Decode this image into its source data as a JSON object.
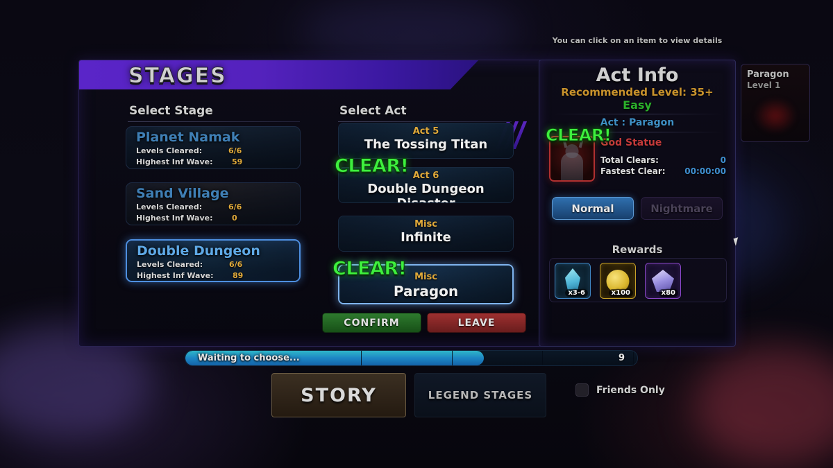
{
  "header": {
    "title": "STAGES"
  },
  "hint": "You can click on an item to view details",
  "columns": {
    "stage": "Select Stage",
    "act": "Select Act"
  },
  "stages": [
    {
      "name": "Planet Namak",
      "levels_label": "Levels Cleared:",
      "levels_value": "6/6",
      "wave_label": "Highest Inf Wave:",
      "wave_value": "59",
      "selected": false
    },
    {
      "name": "Sand Village",
      "levels_label": "Levels Cleared:",
      "levels_value": "6/6",
      "wave_label": "Highest Inf Wave:",
      "wave_value": "0",
      "selected": false
    },
    {
      "name": "Double Dungeon",
      "levels_label": "Levels Cleared:",
      "levels_value": "6/6",
      "wave_label": "Highest Inf Wave:",
      "wave_value": "89",
      "selected": true
    }
  ],
  "acts": [
    {
      "sub": "Act 5",
      "title": "The Tossing Titan",
      "clear": "",
      "selected": false
    },
    {
      "sub": "Act 6",
      "title": "Double Dungeon Disaster",
      "clear": "CLEAR!",
      "selected": false
    },
    {
      "sub": "Misc",
      "title": "Infinite",
      "clear": "",
      "selected": false
    },
    {
      "sub": "Misc",
      "title": "Paragon",
      "clear": "CLEAR!",
      "selected": true
    }
  ],
  "buttons": {
    "confirm": "CONFIRM",
    "leave": "LEAVE"
  },
  "act_info": {
    "title": "Act Info",
    "recommended": "Recommended Level: 35+",
    "difficulty": "Easy",
    "act_name": "Act : Paragon",
    "clear_badge": "CLEAR!",
    "enemy": "God Statue",
    "total_clears_label": "Total Clears:",
    "total_clears_value": "0",
    "fastest_clear_label": "Fastest Clear:",
    "fastest_clear_value": "00:00:00",
    "mode_normal": "Normal",
    "mode_nightmare": "Nightmare",
    "rewards_title": "Rewards",
    "rewards": [
      {
        "icon": "crystal-icon",
        "qty": "x3-6"
      },
      {
        "icon": "coin-icon",
        "qty": "x100"
      },
      {
        "icon": "gem-icon",
        "qty": "x80"
      }
    ],
    "friends_only": "Friends Only"
  },
  "status": {
    "text": "Waiting to choose...",
    "countdown": "9"
  },
  "tabs": [
    {
      "label": "STORY",
      "active": true
    },
    {
      "label": "LEGEND STAGES",
      "active": false
    }
  ],
  "player_card": {
    "name": "Paragon",
    "level": "Level 1"
  },
  "colors": {
    "accent_purple": "#5a25c8",
    "clear_green": "#3ef03e",
    "gold": "#e0a93a",
    "select_blue": "#7fb4ee",
    "enemy_red": "#c43a3a",
    "confirm_green": "#2e7a2e",
    "leave_red": "#9e3030"
  }
}
